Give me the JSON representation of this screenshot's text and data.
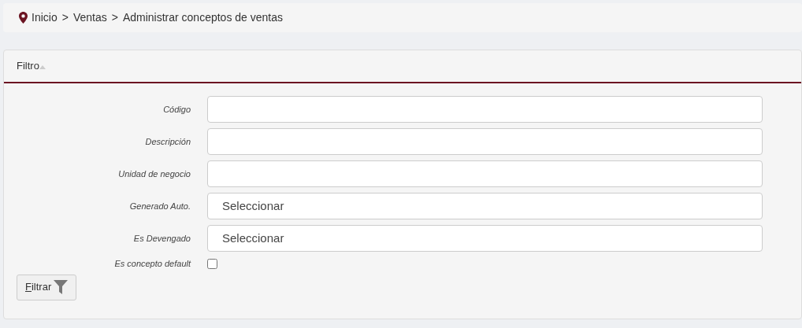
{
  "breadcrumb": [
    {
      "label": "Inicio"
    },
    {
      "label": ">"
    },
    {
      "label": "Ventas"
    },
    {
      "label": ">"
    },
    {
      "label": "Administrar conceptos de ventas"
    }
  ],
  "panel": {
    "title": "Filtro",
    "expanded": true
  },
  "fields": [
    {
      "kind": "text",
      "label": "Código"
    },
    {
      "kind": "text",
      "label": "Descripción"
    },
    {
      "kind": "text",
      "label": "Unidad de negocio"
    },
    {
      "kind": "select",
      "label": "Generado Auto.",
      "value": "Seleccionar"
    },
    {
      "kind": "select",
      "label": "Es Devengado",
      "value": "Seleccionar"
    },
    {
      "kind": "checkbox",
      "label": "Es concepto default",
      "checked": false
    }
  ],
  "button": {
    "label": "Filtrar"
  }
}
